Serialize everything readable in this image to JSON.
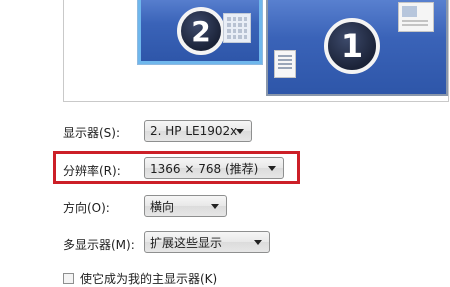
{
  "preview": {
    "monitor_2_number": "2",
    "monitor_1_number": "1"
  },
  "display": {
    "label": "显示器(S):",
    "value": "2. HP LE1902x"
  },
  "resolution": {
    "label": "分辨率(R):",
    "value": "1366 × 768 (推荐)"
  },
  "orientation": {
    "label": "方向(O):",
    "value": "横向"
  },
  "multiple_displays": {
    "label": "多显示器(M):",
    "value": "扩展这些显示"
  },
  "main_display_checkbox": {
    "label": "使它成为我的主显示器(K)"
  },
  "colors": {
    "highlight": "#cc1f27",
    "selected_monitor_border": "#6fb7ec",
    "monitor_fill": "#3a63b8"
  }
}
